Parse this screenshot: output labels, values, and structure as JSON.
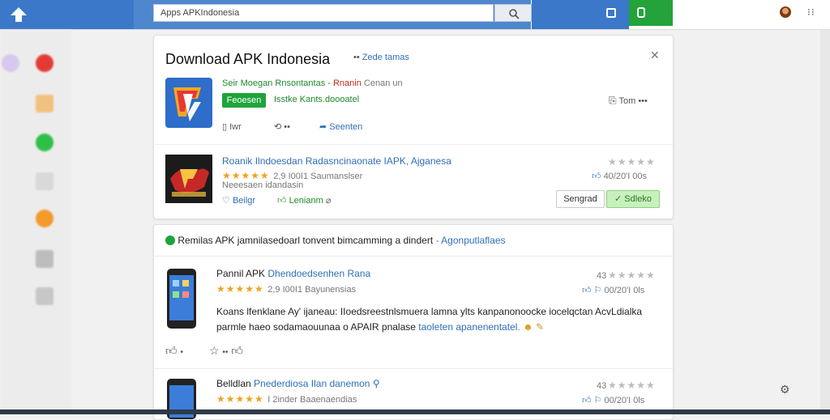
{
  "colors": {
    "brand": "#3b78c9",
    "green": "#1ea43a",
    "star": "#f0a21b"
  },
  "search": {
    "value": "Apps APKIndonesia"
  },
  "left_rail": {
    "icon_colors": [
      "#d8c8ee",
      "#e53935",
      "#f1c27d",
      "#2fbf49",
      "#d9d9d9",
      "#f39a2b",
      "#bdbdbd",
      "#c7c7c7"
    ]
  },
  "main_card": {
    "title": "Download APK Indonesia",
    "title_suffix": "Zede tamas",
    "desc": "Seir Moegan Rnsontantas -",
    "desc_red": "Rnanin",
    "desc_tail": "Cenan un",
    "primary_button": "Feoesen",
    "tagline": "Isstke Kants.doooatel",
    "right_action": "Tom",
    "actions": [
      "Iwr",
      "••",
      "Seenten"
    ],
    "app": {
      "title": "Roanik Ilndoesdan Radasncinaonate IAPK, Ajganesa",
      "rating_meta": "2,9 I00I1 Saumanslser",
      "desc": "Neeesaen idandasin",
      "vote_count": "40/20'I 00s",
      "like_label": "Beilgr",
      "second_label": "Lenianm",
      "secondary_button": "Sengrad",
      "confirm_button": "✓ Sdleko"
    }
  },
  "feed": {
    "header": "Remilas APK jamnilasedoarl tonvent bimcamming a dindert",
    "header_link": "Agonputlaflaes",
    "posts": [
      {
        "title": "Pannil APK",
        "title_link": "Dhendoedsenhen Rana",
        "rating_meta": "2,9 I00I1 Bayunensias",
        "count": "43",
        "vote_count": "00/20'I 0ls",
        "body_line1": "Koans lfenklane Ay' ijaneau: IIoedsreestnlsmuera lamna ylts kanpanonoocke iocelqctan AcvLdialka",
        "body_line2": "parmle haeo sodamaouunaa o APAIR pnalase",
        "body_link": "taoleten apanenentatel."
      },
      {
        "title": "Belldlan",
        "title_link": "Pnederdiosa Ilan danemon",
        "rating_meta": "I 2inder Baaenaendias",
        "count": "43",
        "vote_count": "00/20'I 0ls"
      }
    ]
  }
}
